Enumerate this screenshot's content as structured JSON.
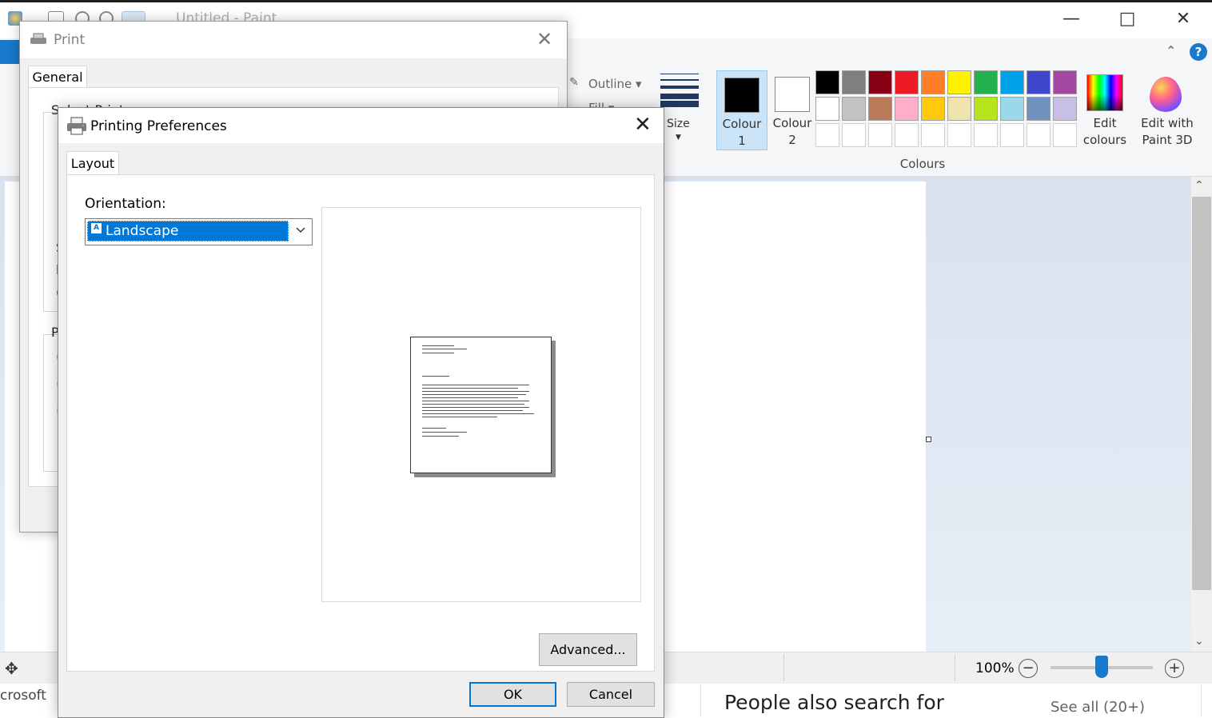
{
  "paint": {
    "title": "Untitled - Paint",
    "ribbon": {
      "outline_label": "Outline",
      "fill_label": "Fill",
      "size_label": "Size",
      "colour1_label": "Colour",
      "colour1_num": "1",
      "colour2_label": "Colour",
      "colour2_num": "2",
      "colours_group": "Colours",
      "edit_colours_l1": "Edit",
      "edit_colours_l2": "colours",
      "paint3d_l1": "Edit with",
      "paint3d_l2": "Paint 3D",
      "colour1_value": "#000000",
      "colour2_value": "#ffffff",
      "palette_row1": [
        "#000000",
        "#7f7f7f",
        "#880015",
        "#ed1c24",
        "#ff7f27",
        "#fff200",
        "#22b14c",
        "#00a2e8",
        "#3f48cc",
        "#a349a4"
      ],
      "palette_row2": [
        "#ffffff",
        "#c3c3c3",
        "#b97a57",
        "#ffaec9",
        "#ffc90e",
        "#efe4b0",
        "#b5e61d",
        "#99d9ea",
        "#7092be",
        "#c8bfe7"
      ]
    },
    "status": {
      "zoom": "100%"
    }
  },
  "browser": {
    "left_fragment": "crosoft",
    "people_title": "People also search for",
    "see_all": "See all (20+)"
  },
  "print_dialog": {
    "title": "Print",
    "tab_general": "General",
    "frag_select": "Select Print",
    "frag_s": "S",
    "frag_l": "l",
    "frag_c": "(",
    "frag_p": "P",
    "frag_r1": "(",
    "frag_r2": "(",
    "frag_r3": "("
  },
  "prefs_dialog": {
    "title": "Printing Preferences",
    "tab_layout": "Layout",
    "orientation_label": "Orientation:",
    "orientation_value": "Landscape",
    "orientation_glyph": "A",
    "advanced_label": "Advanced...",
    "ok_label": "OK",
    "cancel_label": "Cancel"
  }
}
